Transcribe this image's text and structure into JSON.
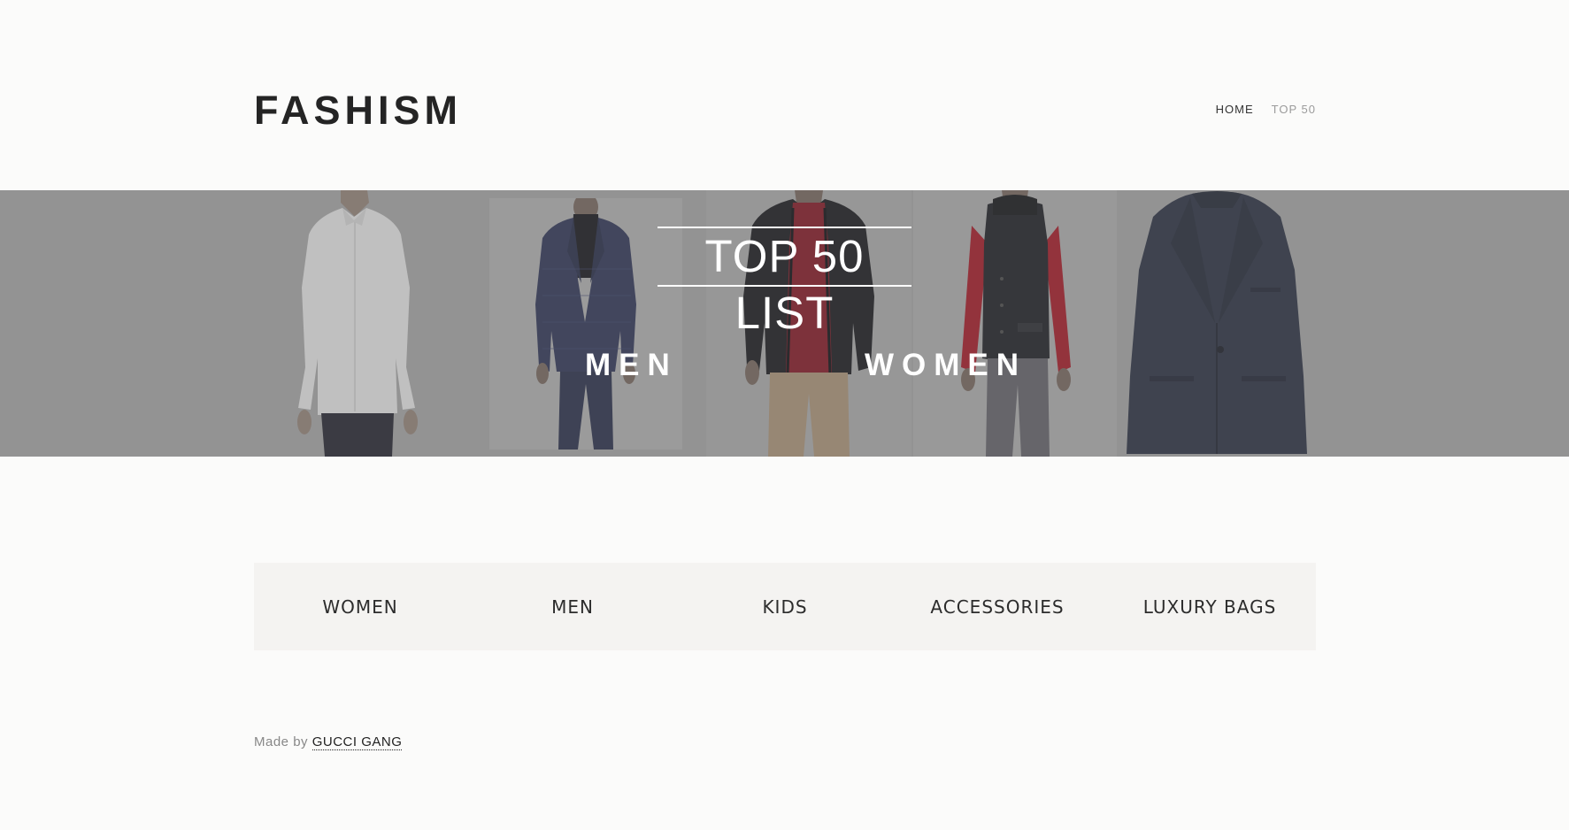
{
  "brand": {
    "logo_text": "FASHISM"
  },
  "nav": {
    "items": [
      {
        "label": "HOME"
      },
      {
        "label": "TOP 50"
      }
    ]
  },
  "hero": {
    "title": "TOP 50 LIST",
    "links": [
      {
        "label": "MEN"
      },
      {
        "label": "WOMEN"
      }
    ],
    "images": [
      {
        "icon": "white-dress-shirt-model"
      },
      {
        "icon": "navy-check-blazer-model"
      },
      {
        "icon": "black-jacket-red-sweater-model"
      },
      {
        "icon": "black-vest-red-shirt-model"
      },
      {
        "icon": "navy-blazer-product"
      }
    ]
  },
  "categories": {
    "items": [
      {
        "label": "WOMEN"
      },
      {
        "label": "MEN"
      },
      {
        "label": "KIDS"
      },
      {
        "label": "ACCESSORIES"
      },
      {
        "label": "LUXURY BAGS"
      }
    ]
  },
  "footer": {
    "prefix": "Made by",
    "link_text": "GUCCI GANG"
  },
  "colors": {
    "page_background": "#fbfbfa",
    "hero_background": "#9a9a9a",
    "category_background": "#f4f3f1",
    "text_dark": "#242424",
    "nav_inactive": "#9b9b9b"
  }
}
